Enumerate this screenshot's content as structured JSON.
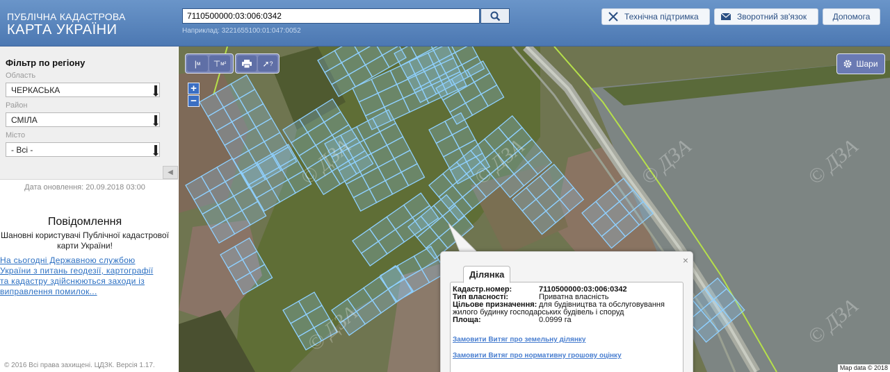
{
  "header": {
    "logo_line1": "ПУБЛІЧНА КАДАСТРОВА",
    "logo_line2": "КАРТА УКРАЇНИ",
    "search_value": "7110500000:03:006:0342",
    "search_hint": "Наприклад: 3221655100:01:047:0052",
    "buttons": {
      "support": "Технічна підтримка",
      "feedback": "Зворотний зв'язок",
      "help": "Допомога"
    }
  },
  "sidebar": {
    "filter_title": "Фільтр по регіону",
    "region_label": "Область",
    "region_value": "ЧЕРКАСЬКА",
    "district_label": "Район",
    "district_value": "СМІЛА",
    "city_label": "Місто",
    "city_value": "- Всі -",
    "update_date": "Дата оновлення: 20.09.2018 03:00",
    "news_title": "Повідомлення",
    "news_greeting": "Шановні користувачі Публічної кадастрової карти України!",
    "news_text": "На сьогодні Державною службою\nУкраїни з питань геодезії, картографії\nта кадастру здійснюються заходи із\nвиправлення помилок...",
    "copyright": "© 2016 Всі права захищені. ЦДЗК. Версія 1.17."
  },
  "map": {
    "layers_button": "Шари",
    "tool_labels": {
      "measure_length_sub": "м",
      "measure_area_sub": "м²",
      "identify": "?"
    },
    "zoom_in": "+",
    "zoom_out": "−",
    "watermark": "© ДЗА",
    "attribution": "Map data © 2018"
  },
  "popup": {
    "tab": "Ділянка",
    "close": "×",
    "rows": {
      "cadastral_label": "Кадастр.номер:",
      "cadastral_value": "7110500000:03:006:0342",
      "ownership_label": "Тип власності:",
      "ownership_value": "Приватна власність",
      "purpose_label": "Цільове призначення:",
      "purpose_value": "для будівництва та обслуговування",
      "purpose_cont": "жилого будинку господарських будівель і споруд",
      "area_label": "Площа:",
      "area_value": "0.0999 га"
    },
    "links": {
      "extract_land": "Замовити Витяг про земельну ділянку",
      "extract_valuation": "Замовити Витяг про нормативну грошову оцінку"
    }
  },
  "colors": {
    "header": "#5a86bf",
    "parcel_outline": "#8fd0ff",
    "field_green": "#6b7a3c",
    "link": "#2b6fc2"
  }
}
